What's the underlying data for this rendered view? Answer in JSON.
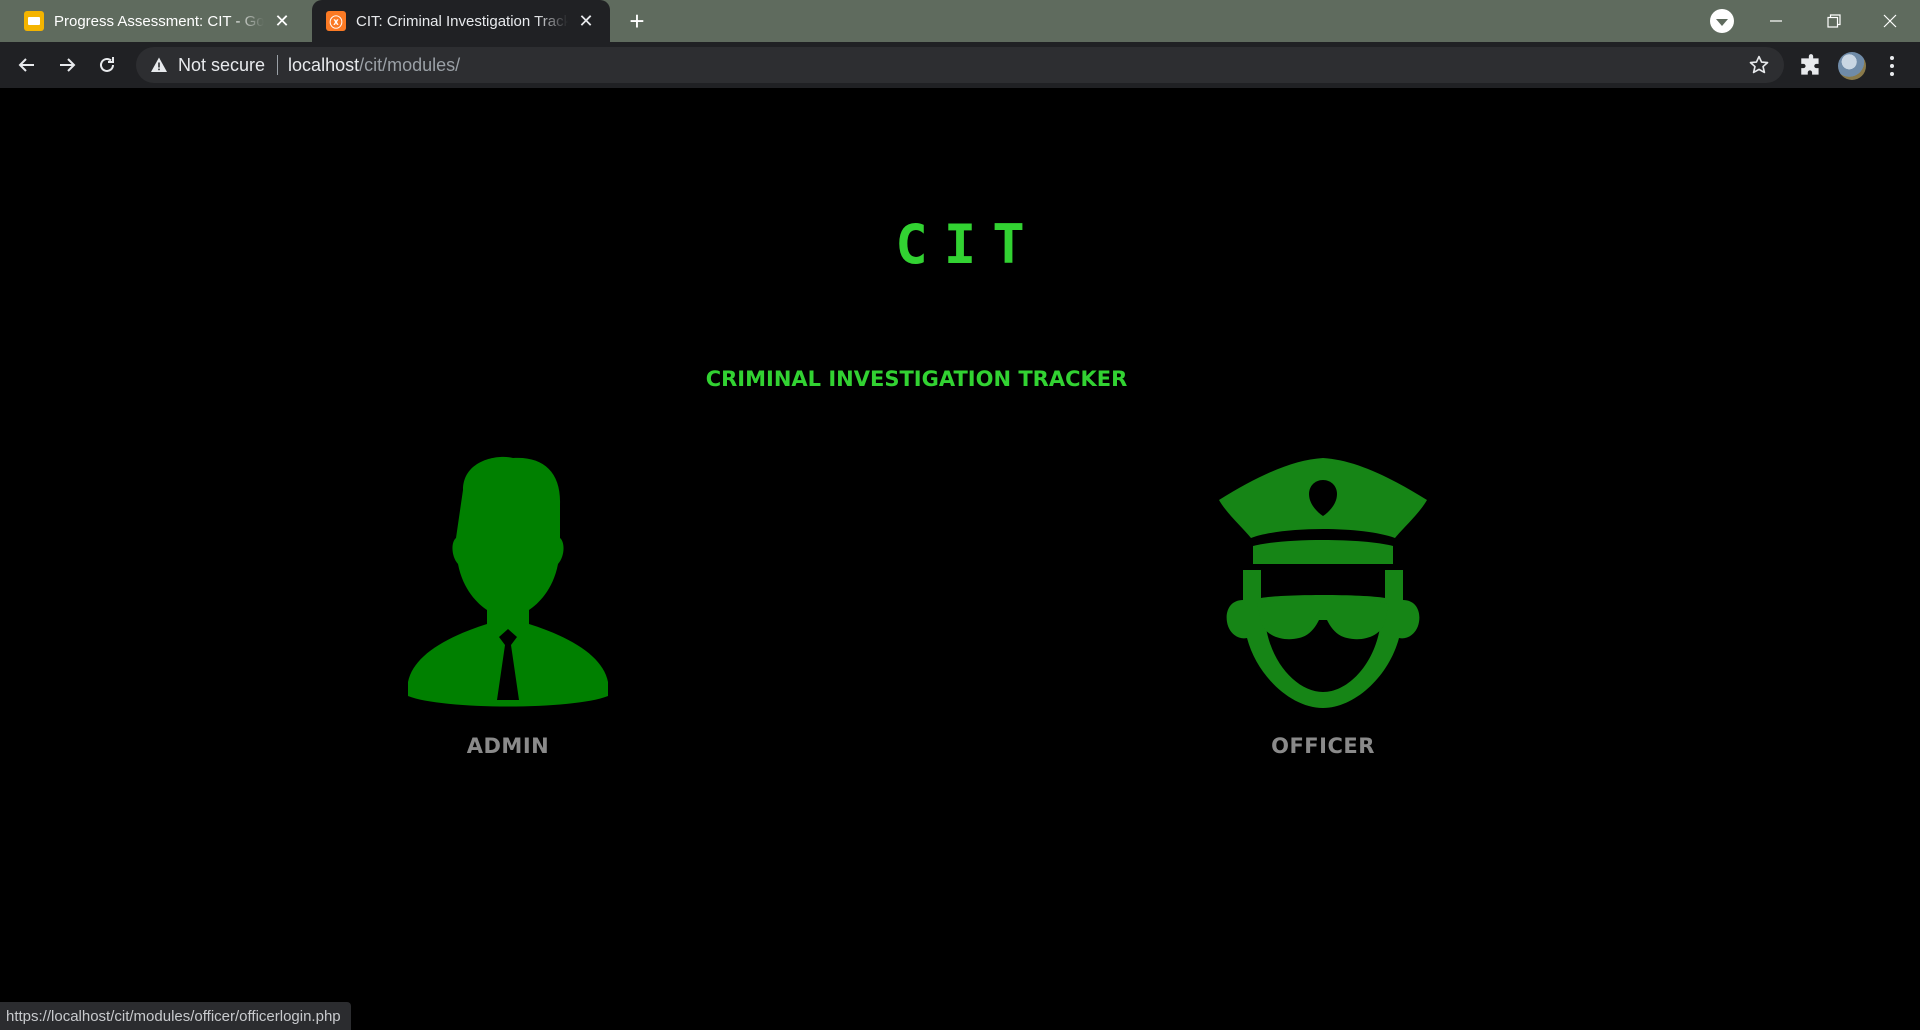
{
  "browser": {
    "tabs": [
      {
        "title": "Progress Assessment: CIT - Goog",
        "icon": "google-slides-icon",
        "active": false
      },
      {
        "title": "CIT: Criminal Investigation Tracke",
        "icon": "xampp-icon",
        "active": true
      }
    ],
    "new_tab_label": "+",
    "security_label": "Not secure",
    "url_host": "localhost",
    "url_path": "/cit/modules/"
  },
  "page": {
    "logo_text": "CIT",
    "subtitle": "CRIMINAL INVESTIGATION TRACKER",
    "roles": [
      {
        "label": "ADMIN",
        "icon": "admin-user-icon",
        "color": "#008000"
      },
      {
        "label": "OFFICER",
        "icon": "police-officer-icon",
        "color": "#168516"
      }
    ]
  },
  "status_bar": {
    "hover_url": "https://localhost/cit/modules/officer/officerlogin.php"
  },
  "colors": {
    "accent": "#32d232",
    "label_gray": "#8a8a8a",
    "background": "#000000"
  }
}
